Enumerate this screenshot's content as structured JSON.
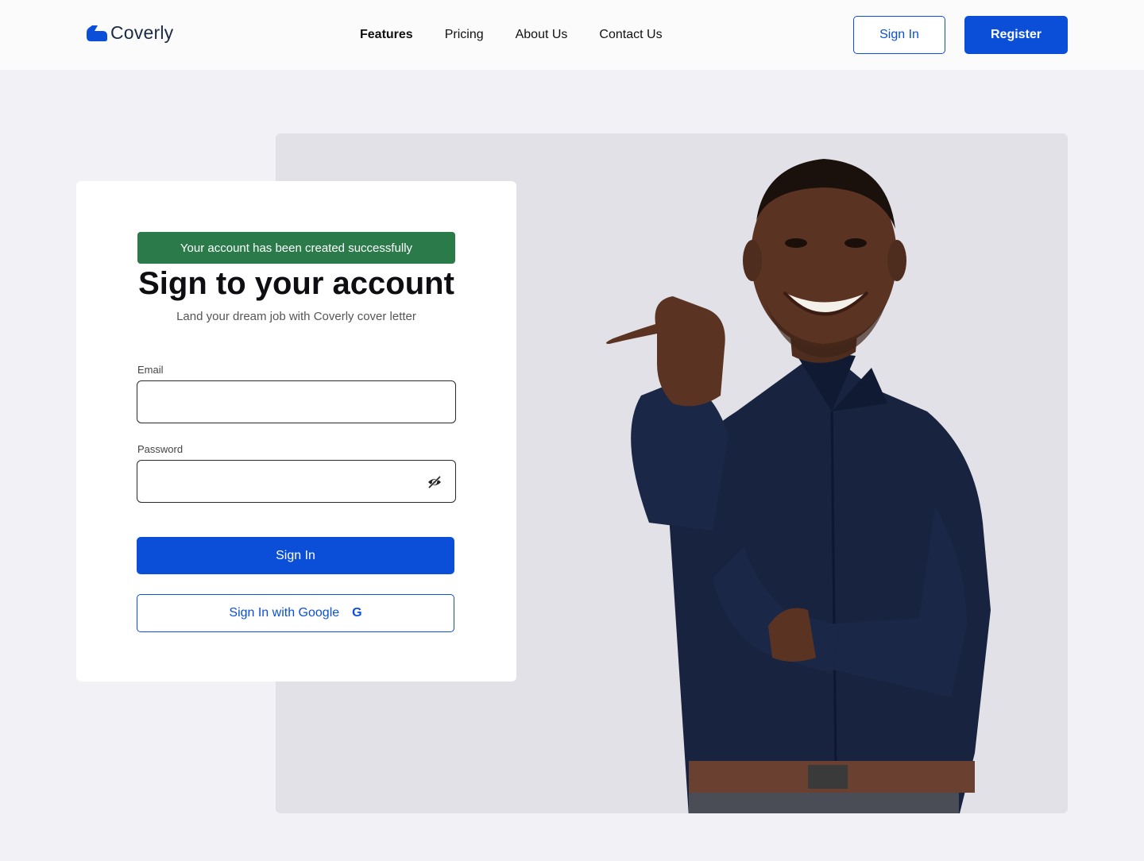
{
  "brand": {
    "name": "Coverly",
    "accent_color": "#0b4fd9",
    "success_color": "#2b7a4a"
  },
  "nav": {
    "items": [
      {
        "label": "Features"
      },
      {
        "label": "Pricing"
      },
      {
        "label": "About Us"
      },
      {
        "label": "Contact Us"
      }
    ],
    "signin_label": "Sign In",
    "register_label": "Register"
  },
  "form": {
    "alert": "Your account has been created successfully",
    "title": "Sign to your account",
    "subtitle": "Land your dream job with Coverly cover letter",
    "email_label": "Email",
    "email_value": "",
    "password_label": "Password",
    "password_value": "",
    "password_toggle_icon": "eye-off-icon",
    "submit_label": "Sign In",
    "google_label": "Sign In with Google",
    "google_icon": "google-icon",
    "google_glyph": "G"
  },
  "hero": {
    "image": "smiling man in navy shirt pointing thumb to the left"
  }
}
